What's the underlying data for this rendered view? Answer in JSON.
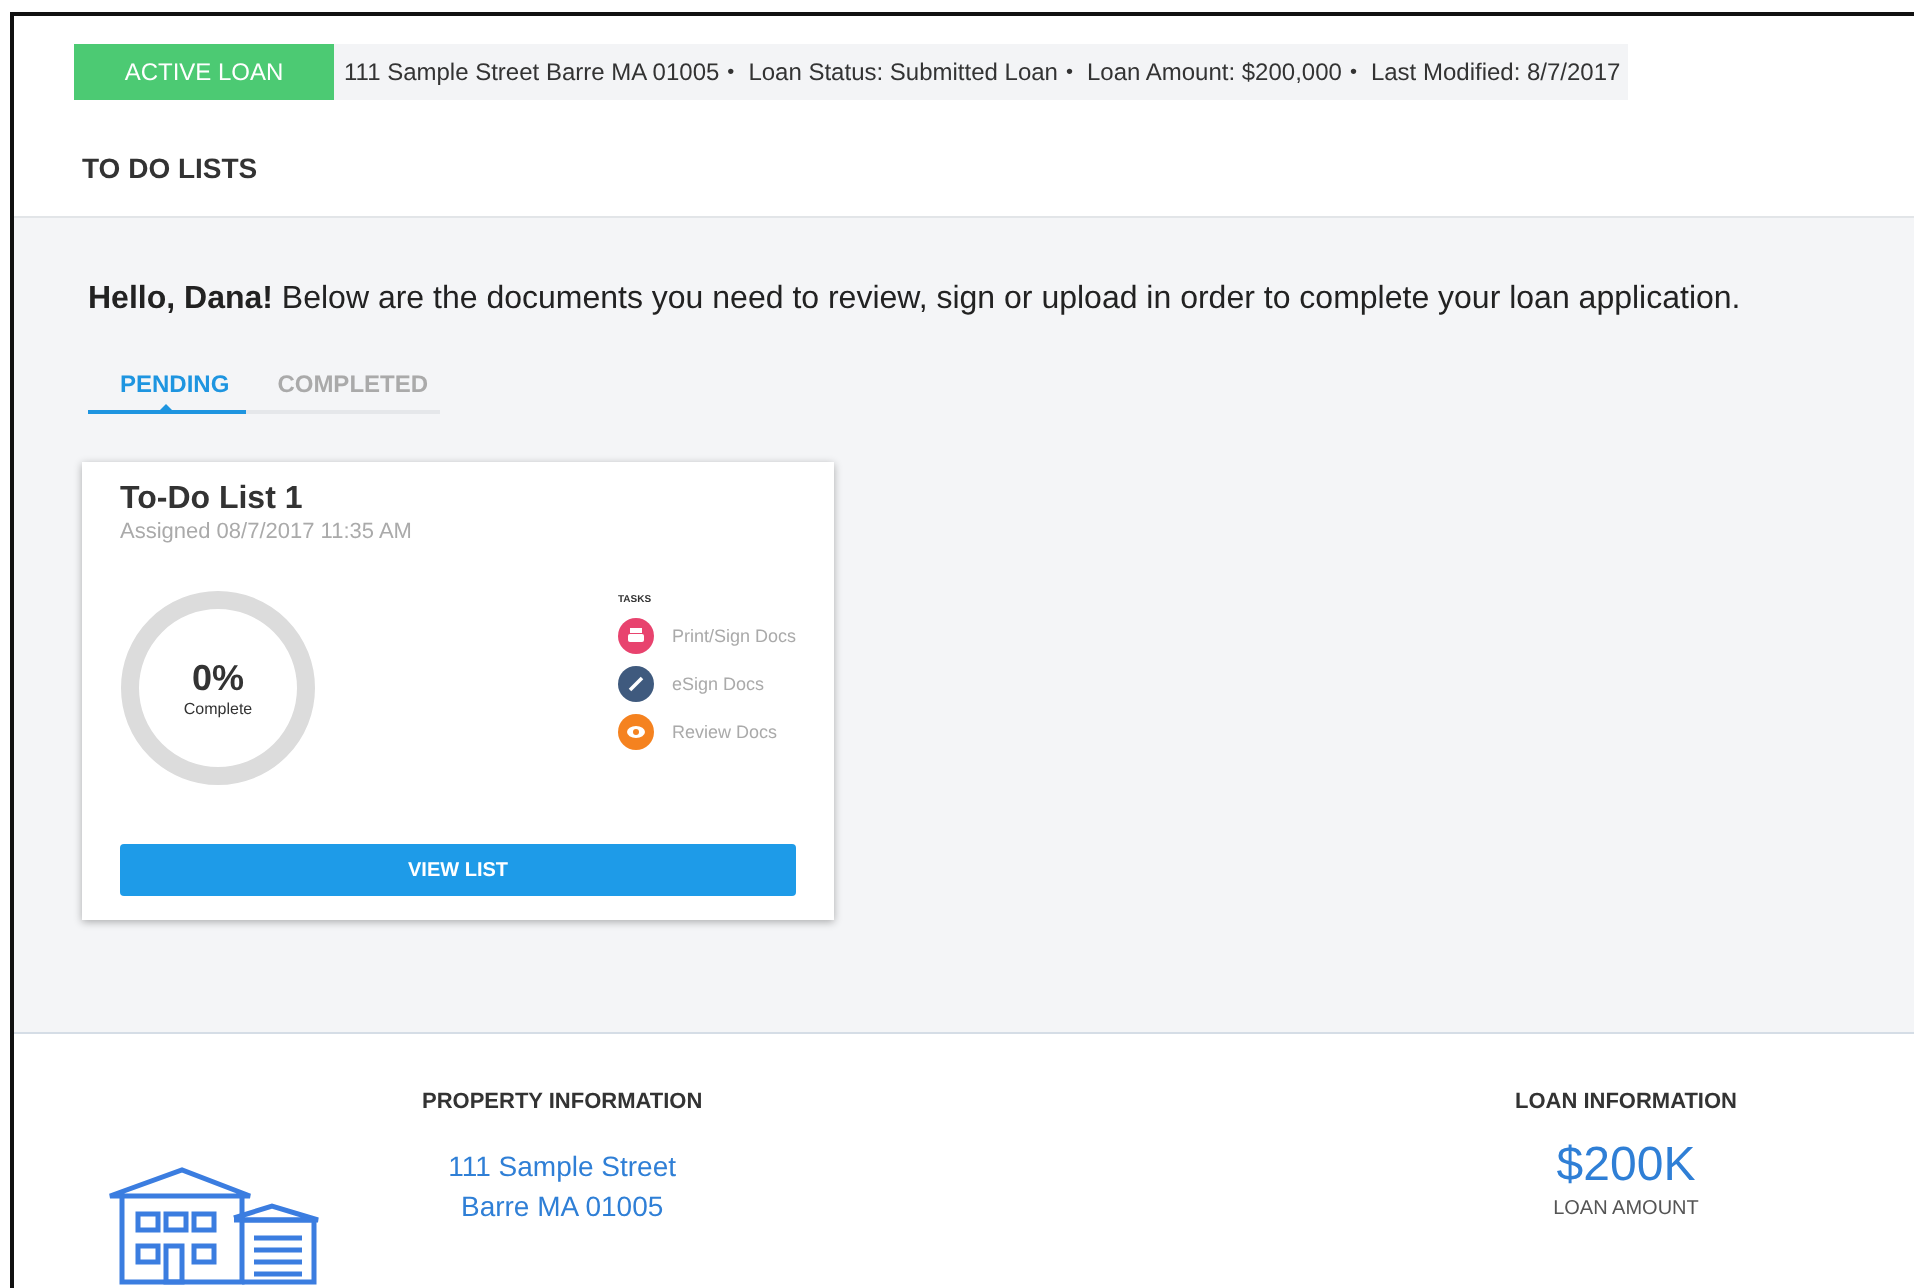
{
  "loan_bar": {
    "badge": "ACTIVE LOAN",
    "details": [
      "111 Sample Street Barre MA 01005",
      "Loan Status: Submitted Loan",
      "Loan Amount: $200,000",
      "Last Modified: 8/7/2017"
    ],
    "separator": "•"
  },
  "section_title": "TO DO LISTS",
  "greeting": "**Hello, Dana!** Below are the documents you need to review, sign or upload in order to complete your loan application.",
  "tabs": [
    {
      "label": "PENDING",
      "selected": true
    },
    {
      "label": "COMPLETED",
      "selected": false
    }
  ],
  "todo_cards": [
    {
      "title": "To-Do List 1",
      "assigned": "Assigned 08/7/2017 11:35 AM",
      "progress": {
        "percent": "0%",
        "caption": "Complete"
      },
      "tasks_label": "TASKS",
      "tasks": [
        {
          "kind": "print",
          "label": "Print/Sign Docs",
          "color": "#e8436e"
        },
        {
          "kind": "esign",
          "label": "eSign Docs",
          "color": "#3f5a7e"
        },
        {
          "kind": "review",
          "label": "Review Docs",
          "color": "#f5821f"
        }
      ],
      "button": "VIEW LIST"
    }
  ],
  "property": {
    "heading": "PROPERTY INFORMATION",
    "address_lines": [
      "111 Sample Street",
      "Barre MA 01005"
    ]
  },
  "loan": {
    "heading": "LOAN INFORMATION",
    "amount": "$200K",
    "caption": "LOAN AMOUNT"
  }
}
